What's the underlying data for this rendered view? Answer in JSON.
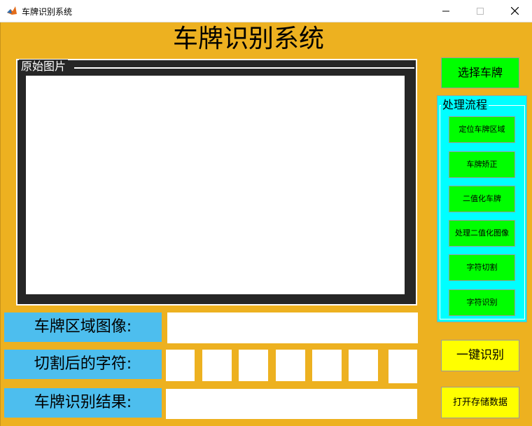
{
  "window": {
    "title": "车牌识别系统",
    "min_glyph": "—",
    "max_glyph": "☐",
    "close_glyph": "✕"
  },
  "app": {
    "heading": "车牌识别系统"
  },
  "original_panel": {
    "legend": "原始图片"
  },
  "rows": {
    "plate_region_label": "车牌区域图像:",
    "chars_label": "切割后的字符:",
    "result_label": "车牌识别结果:"
  },
  "buttons": {
    "select_plate": "选择车牌",
    "one_click": "一键识别",
    "open_save": "打开存储数据"
  },
  "process": {
    "legend": "处理流程",
    "steps": [
      "定位车牌区域",
      "车牌矫正",
      "二值化车牌",
      "处理二值化图像",
      "字符切割",
      "字符识别"
    ]
  },
  "colors": {
    "background": "#edb120",
    "label_blue": "#4dbeee",
    "button_green": "#00ff00",
    "panel_cyan": "#00ffff",
    "button_yellow": "#ffff00"
  },
  "icons": {
    "app": "matlab-icon"
  }
}
